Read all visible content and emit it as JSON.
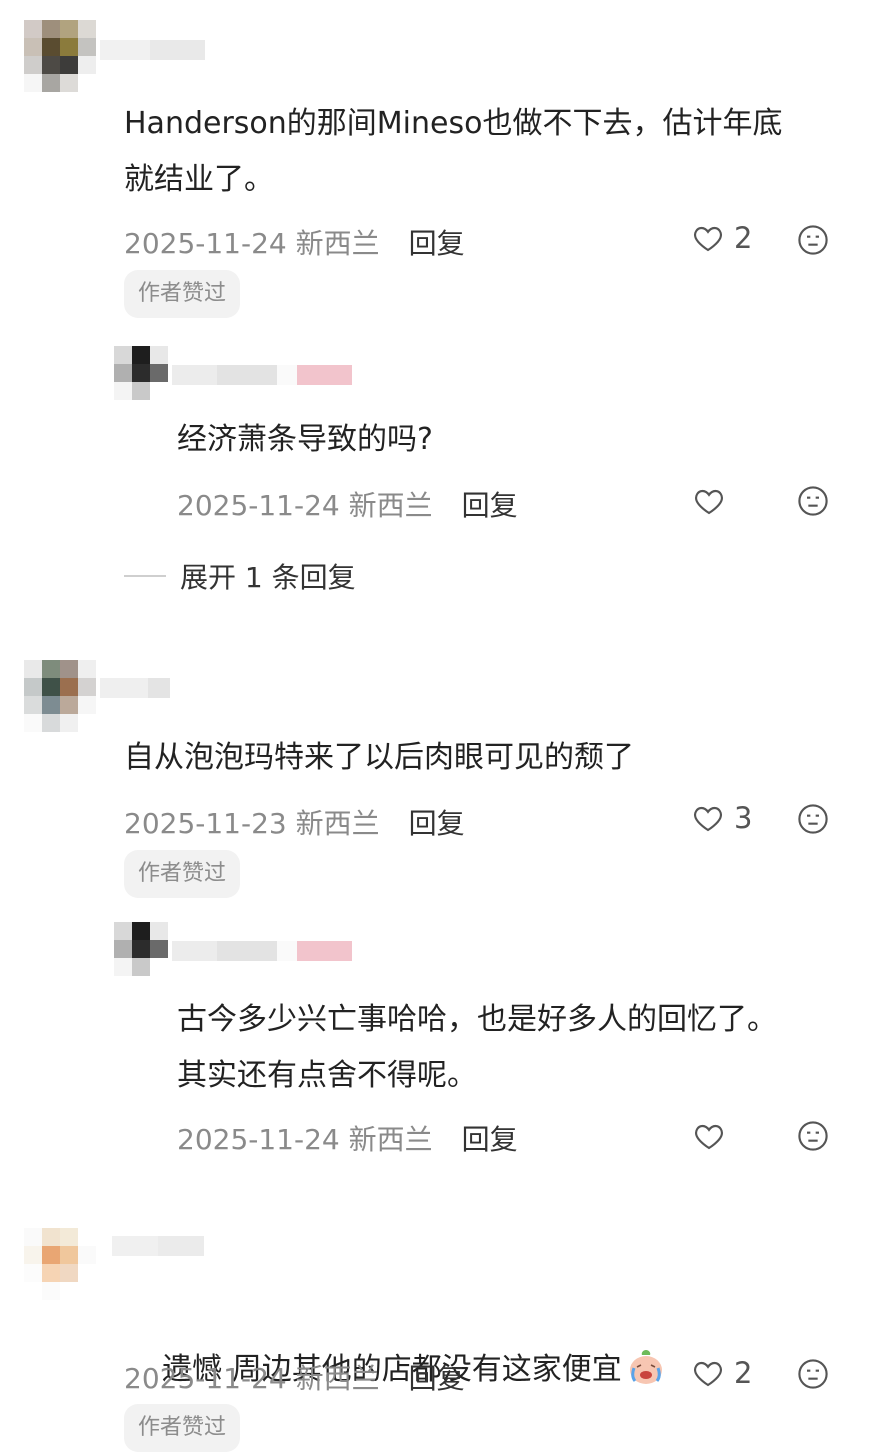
{
  "comments": [
    {
      "text": "Handerson的那间Mineso也做不下去，估计年底\n就结业了。",
      "date": "2025-11-24",
      "location": "新西兰",
      "reply_label": "回复",
      "likes": "2",
      "badge": "作者赞过",
      "reply": {
        "text": "经济萧条导致的吗?",
        "date": "2025-11-24",
        "location": "新西兰",
        "reply_label": "回复"
      },
      "expand_label": "展开 1 条回复"
    },
    {
      "text": "自从泡泡玛特来了以后肉眼可见的颓了",
      "date": "2025-11-23",
      "location": "新西兰",
      "reply_label": "回复",
      "likes": "3",
      "badge": "作者赞过",
      "reply": {
        "text": "古今多少兴亡事哈哈，也是好多人的回忆了。\n其实还有点舍不得呢。",
        "date": "2025-11-24",
        "location": "新西兰",
        "reply_label": "回复"
      }
    },
    {
      "text": "遗憾 周边其他的店都没有这家便宜",
      "emoji": "crying-face-emoji",
      "date": "2025-11-24",
      "location": "新西兰",
      "reply_label": "回复",
      "likes": "2",
      "badge": "作者赞过"
    }
  ],
  "icons": {
    "like": "heart-outline-icon",
    "dislike": "unhappy-face-icon"
  },
  "colors": {
    "text": "#222222",
    "meta": "#8a8a8a",
    "badge_bg": "#f2f2f2"
  }
}
